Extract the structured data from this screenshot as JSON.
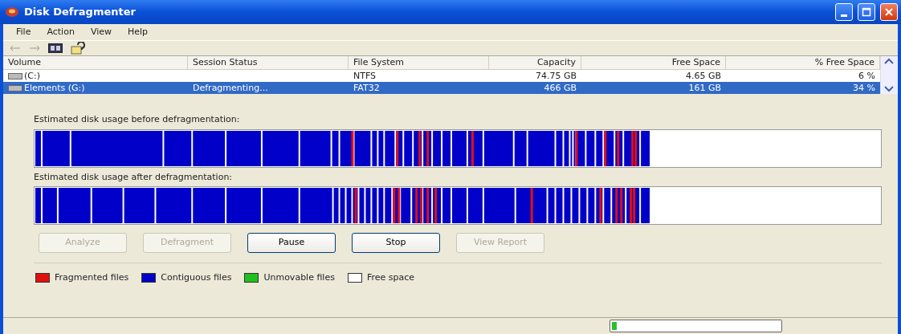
{
  "window": {
    "title": "Disk Defragmenter"
  },
  "menu": [
    "File",
    "Action",
    "View",
    "Help"
  ],
  "table": {
    "columns": [
      "Volume",
      "Session Status",
      "File System",
      "Capacity",
      "Free Space",
      "% Free Space"
    ],
    "rows": [
      {
        "cells": [
          "(C:)",
          "",
          "NTFS",
          "74.75 GB",
          "4.65 GB",
          "6 %"
        ],
        "selected": false
      },
      {
        "cells": [
          "Elements (G:)",
          "Defragmenting...",
          "FAT32",
          "466 GB",
          "161 GB",
          "34 %"
        ],
        "selected": true
      }
    ]
  },
  "before_label": "Estimated disk usage before defragmentation:",
  "after_label": "Estimated disk usage after defragmentation:",
  "buttons": [
    {
      "label": "Analyze",
      "disabled": true
    },
    {
      "label": "Defragment",
      "disabled": true
    },
    {
      "label": "Pause",
      "disabled": false
    },
    {
      "label": "Stop",
      "disabled": false
    },
    {
      "label": "View Report",
      "disabled": true
    }
  ],
  "legend": [
    {
      "label": "Fragmented files",
      "color": "#e01010"
    },
    {
      "label": "Contiguous files",
      "color": "#0000c8"
    },
    {
      "label": "Unmovable files",
      "color": "#20c020"
    },
    {
      "label": "Free space",
      "color": "#ffffff"
    }
  ],
  "status_bar": {
    "progress": {
      "level": 0.03
    }
  }
}
